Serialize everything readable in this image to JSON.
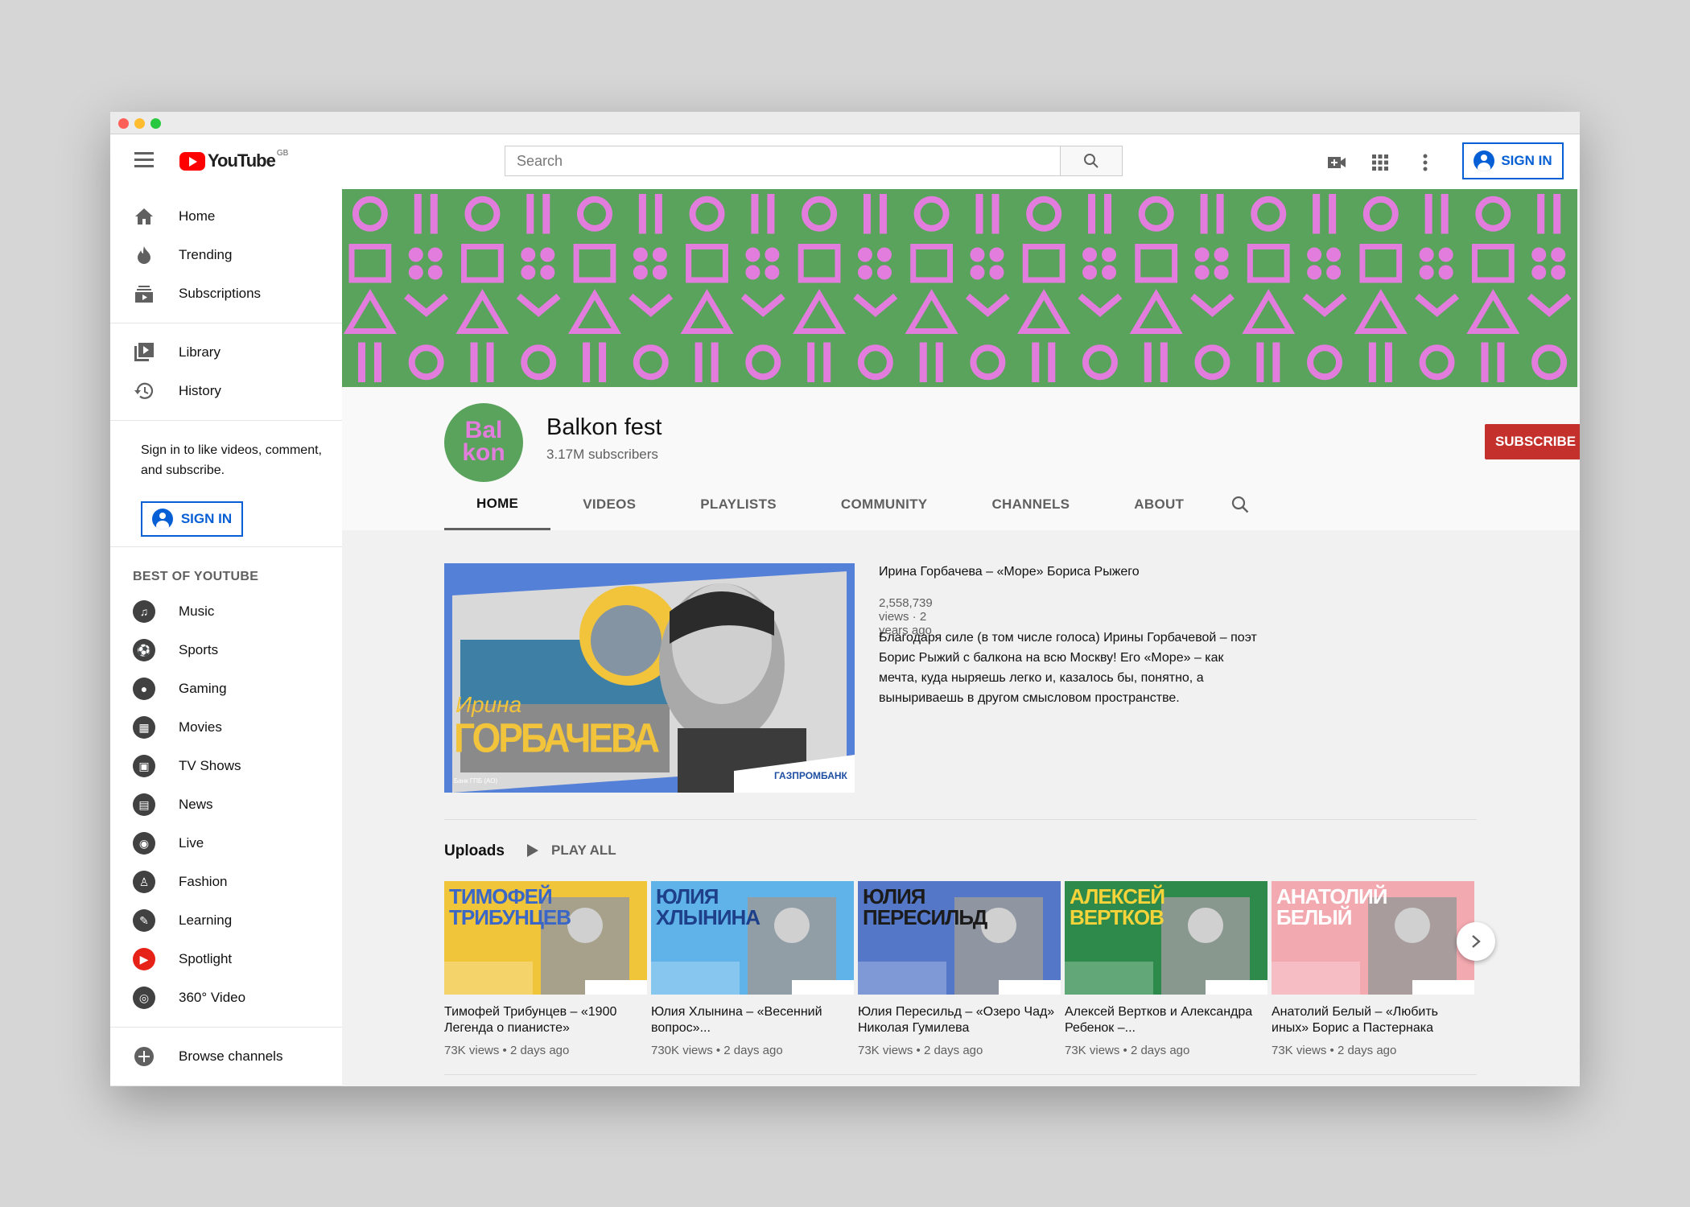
{
  "header": {
    "logo_text": "YouTube",
    "region": "GB",
    "search_placeholder": "Search",
    "sign_in": "SIGN IN",
    "icons": [
      "video-camera-icon",
      "apps-grid-icon",
      "more-vert-icon"
    ]
  },
  "sidebar": {
    "primary": [
      {
        "label": "Home",
        "icon": "home-icon"
      },
      {
        "label": "Trending",
        "icon": "fire-icon"
      },
      {
        "label": "Subscriptions",
        "icon": "subscriptions-icon"
      }
    ],
    "secondary": [
      {
        "label": "Library",
        "icon": "library-icon"
      },
      {
        "label": "History",
        "icon": "history-icon"
      }
    ],
    "signin_prompt": "Sign in to like videos, comment, and subscribe.",
    "signin_button": "SIGN IN",
    "best_title": "BEST OF YOUTUBE",
    "best": [
      {
        "label": "Music",
        "glyph": "♫"
      },
      {
        "label": "Sports",
        "glyph": "⚽"
      },
      {
        "label": "Gaming",
        "glyph": "●"
      },
      {
        "label": "Movies",
        "glyph": "▦"
      },
      {
        "label": "TV Shows",
        "glyph": "▣"
      },
      {
        "label": "News",
        "glyph": "▤"
      },
      {
        "label": "Live",
        "glyph": "◉"
      },
      {
        "label": "Fashion",
        "glyph": "♙"
      },
      {
        "label": "Learning",
        "glyph": "✎"
      },
      {
        "label": "Spotlight",
        "glyph": "▶"
      },
      {
        "label": "360° Video",
        "glyph": "◎"
      }
    ],
    "browse": "Browse channels"
  },
  "channel": {
    "avatar_text": "Bal kon",
    "name": "Balkon fest",
    "subscribers": "3.17M subscribers",
    "subscribe": "SUBSCRIBE",
    "tabs": [
      "HOME",
      "VIDEOS",
      "PLAYLISTS",
      "COMMUNITY",
      "CHANNELS",
      "ABOUT"
    ],
    "active_tab": "HOME"
  },
  "featured": {
    "thumb_name_small": "Ирина",
    "thumb_name_big": "ГОРБАЧЕВА",
    "thumb_brand": "ГАЗПРОМБАНК",
    "thumb_bank": "Банк ГПБ (АО)",
    "title": "Ирина Горбачева – «Море» Бориса Рыжего",
    "meta": "2,558,739 views · 2 years ago",
    "description": "Благодаря силе (в том числе голоса) Ирины Горбачевой – поэт Борис Рыжий с балкона на всю Москву! Его «Море» – как мечта, куда ныряешь легко и, казалось бы, понятно, а выныриваешь в другом смысловом пространстве."
  },
  "uploads": {
    "title": "Uploads",
    "play_all": "PLAY ALL",
    "videos": [
      {
        "thumb": "ТИМОФЕЙ ТРИБУНЦЕВ",
        "title": "Тимофей Трибунцев – «1900 Легенда о пианисте»",
        "meta": "73K views • 2 days ago",
        "bg": "#f0c53a",
        "fg": "#3a66c7"
      },
      {
        "thumb": "ЮЛИЯ ХЛЫНИНА",
        "title": "Юлия Хлынина – «Весенний вопрос»...",
        "meta": "730K views • 2 days ago",
        "bg": "#5fb3e8",
        "fg": "#1e3f8a"
      },
      {
        "thumb": "ЮЛИЯ ПЕРЕСИЛЬД",
        "title": "Юлия Пересильд – «Озеро Чад» Николая Гумилева",
        "meta": "73K views • 2 days ago",
        "bg": "#5577c8",
        "fg": "#1b1b1b"
      },
      {
        "thumb": "АЛЕКСЕЙ ВЕРТКОВ",
        "title": "Алексей Вертков и Александра Ребенок –...",
        "meta": "73K views • 2 days ago",
        "bg": "#2d8a4a",
        "fg": "#f5d33a"
      },
      {
        "thumb": "АНАТОЛИЙ БЕЛЫЙ",
        "title": "Анатолий Белый – «Любить иных» Борис а Пастернака",
        "meta": "73K views • 2 days ago",
        "bg": "#f3a9b0",
        "fg": "#ffffff"
      }
    ]
  }
}
